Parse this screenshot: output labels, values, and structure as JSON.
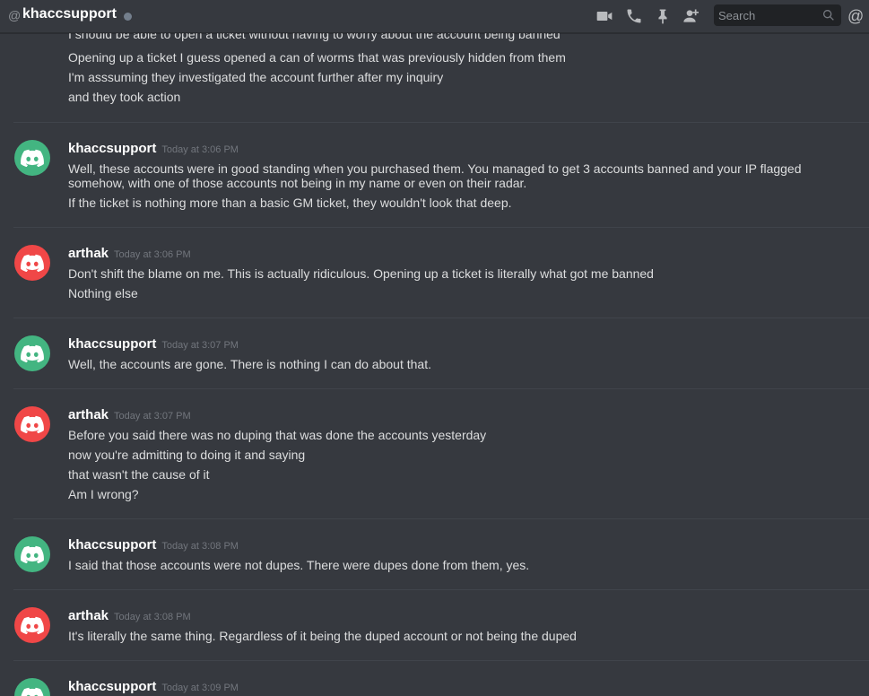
{
  "header": {
    "at_symbol": "@",
    "channel_name": "khaccsupport",
    "search_placeholder": "Search",
    "mention_symbol": "@"
  },
  "colors": {
    "background": "#36393f",
    "username": "#ffffff",
    "message_text": "#dcddde",
    "timestamp": "#72767d",
    "avatar_green": "#43b581",
    "avatar_red": "#f04747",
    "status_offline": "#747f8d"
  },
  "icons": [
    "video-camera-icon",
    "phone-icon",
    "pin-icon",
    "add-friend-icon",
    "search-icon",
    "mention-icon"
  ],
  "messages": [
    {
      "author": "",
      "timestamp": "",
      "lines": [
        "I should be able to open a ticket without having to worry about the account being banned",
        "Opening up a ticket I guess opened a can of worms that was previously hidden from them",
        "I'm asssuming they investigated the account further after my inquiry",
        "and they took action"
      ]
    },
    {
      "author": "khaccsupport",
      "timestamp": "Today at 3:06 PM",
      "avatar_color": "green",
      "lines": [
        "Well, these accounts were in good standing when you purchased them.  You managed to get 3 accounts banned and your IP flagged somehow, with one of those accounts not being in my name or even on their radar.",
        "If the ticket is nothing more than a basic GM ticket, they wouldn't look that deep."
      ]
    },
    {
      "author": "arthak",
      "timestamp": "Today at 3:06 PM",
      "avatar_color": "red",
      "lines": [
        "Don't shift the blame on me. This is actually ridiculous. Opening up a ticket is literally what got me banned",
        "Nothing else"
      ]
    },
    {
      "author": "khaccsupport",
      "timestamp": "Today at 3:07 PM",
      "avatar_color": "green",
      "lines": [
        "Well, the accounts are gone.  There is nothing I can do about that."
      ]
    },
    {
      "author": "arthak",
      "timestamp": "Today at 3:07 PM",
      "avatar_color": "red",
      "lines": [
        "Before you said there was no duping that was done the accounts yesterday",
        "now you're admitting to doing it and saying",
        "that wasn't the cause of it",
        "Am I wrong?"
      ]
    },
    {
      "author": "khaccsupport",
      "timestamp": "Today at 3:08 PM",
      "avatar_color": "green",
      "lines": [
        "I said that those accounts were not dupes.  There were dupes done from them, yes."
      ]
    },
    {
      "author": "arthak",
      "timestamp": "Today at 3:08 PM",
      "avatar_color": "red",
      "lines": [
        "It's literally the same thing. Regardless of it being the duped account or not being the duped"
      ]
    },
    {
      "author": "khaccsupport",
      "timestamp": "Today at 3:09 PM",
      "avatar_color": "green",
      "lines": []
    }
  ]
}
